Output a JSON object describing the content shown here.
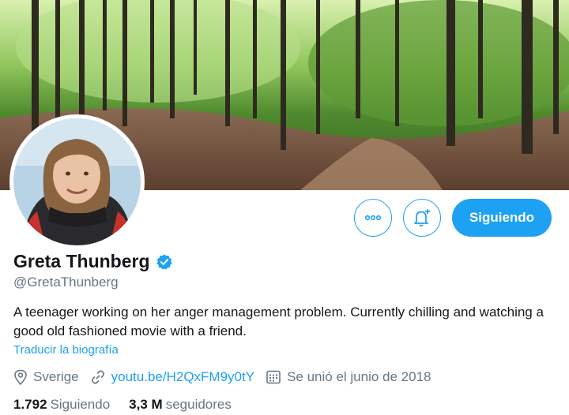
{
  "profile": {
    "name": "Greta Thunberg",
    "handle": "@GretaThunberg",
    "bio": "A teenager working on her anger management problem. Currently chilling and watching a good old fashioned movie with a friend.",
    "translate_label": "Traducir la biografía",
    "location": "Sverige",
    "website": "youtu.be/H2QxFM9y0tY",
    "joined": "Se unió el junio de 2018",
    "verified_icon": "verified-badge-icon"
  },
  "actions": {
    "more_icon": "more-horizontal-icon",
    "notify_icon": "bell-plus-icon",
    "follow_label": "Siguiendo"
  },
  "stats": {
    "following_count": "1.792",
    "following_label": "Siguiendo",
    "followers_count": "3,3 M",
    "followers_label": "seguidores"
  },
  "colors": {
    "accent": "#1da1f2",
    "secondary_text": "#657786",
    "primary_text": "#14171a"
  }
}
